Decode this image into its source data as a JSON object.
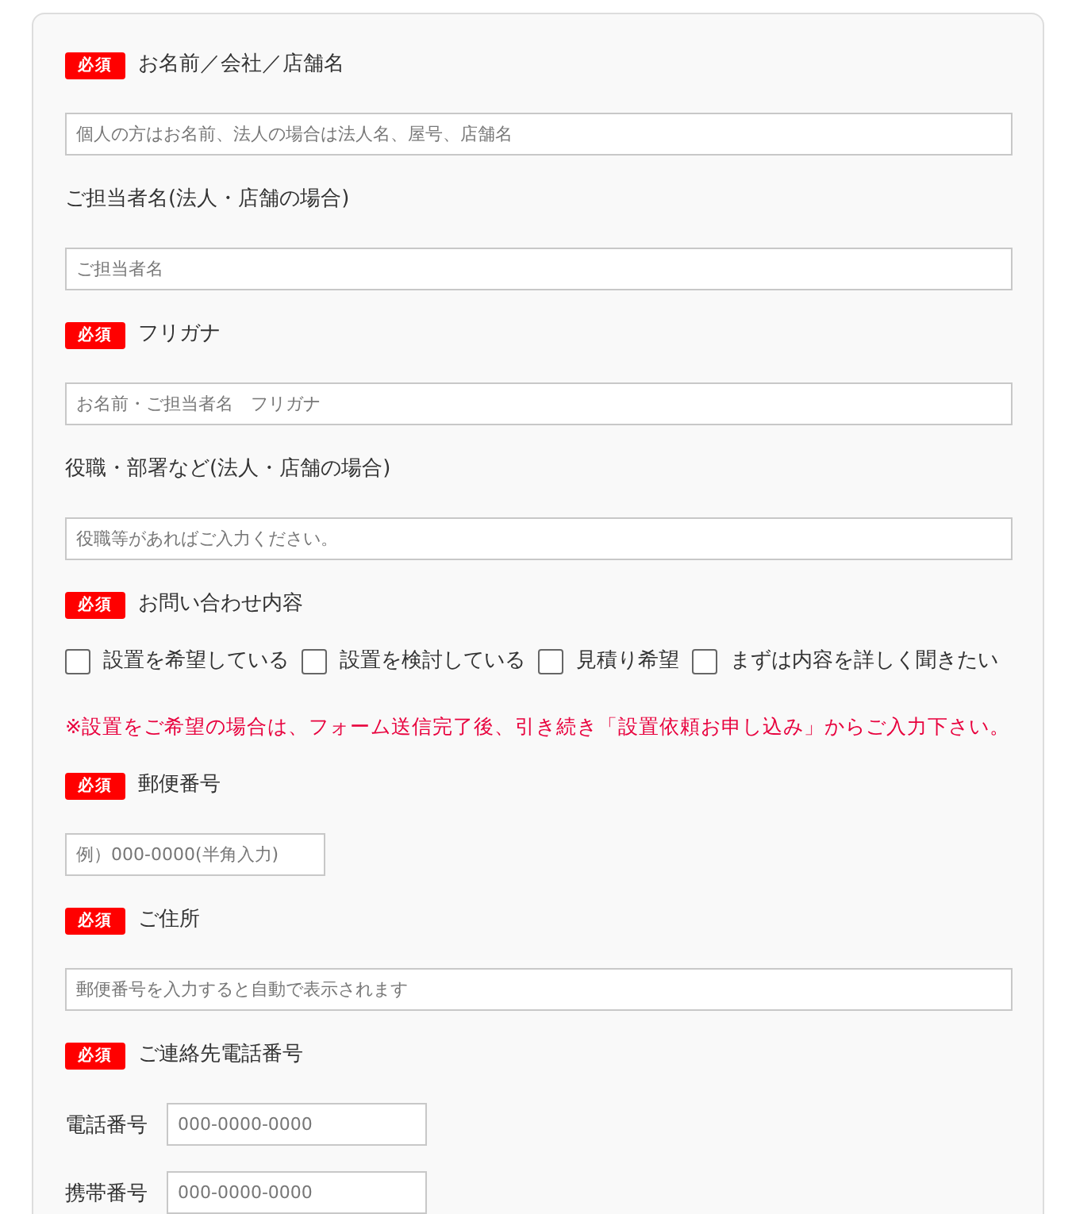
{
  "sections": [
    {
      "kind": "text",
      "badge": "必須",
      "label": "お名前／会社／店舗名",
      "placeholder": "個人の方はお名前、法人の場合は法人名、屋号、店舗名"
    },
    {
      "kind": "text",
      "label": "ご担当者名(法人・店舗の場合)",
      "placeholder": "ご担当者名"
    },
    {
      "kind": "text",
      "badge": "必須",
      "label": "フリガナ",
      "placeholder": "お名前・ご担当者名　フリガナ"
    },
    {
      "kind": "text",
      "label": "役職・部署など(法人・店舗の場合)",
      "placeholder": "役職等があればご入力ください。"
    },
    {
      "kind": "checkboxes",
      "badge": "必須",
      "label": "お問い合わせ内容",
      "options": [
        {
          "label": "設置を希望している",
          "checked": false
        },
        {
          "label": "設置を検討している",
          "checked": false
        },
        {
          "label": "見積り希望",
          "checked": false
        },
        {
          "label": "まずは内容を詳しく聞きたい",
          "checked": false
        }
      ],
      "note": "※設置をご希望の場合は、フォーム送信完了後、引き続き「設置依頼お申し込み」からご入力下さい。"
    },
    {
      "kind": "short_text",
      "badge": "必須",
      "label": "郵便番号",
      "placeholder": "例）000-0000(半角入力)"
    },
    {
      "kind": "text",
      "badge": "必須",
      "label": "ご住所",
      "placeholder": "郵便番号を入力すると自動で表示されます"
    },
    {
      "kind": "phones",
      "badge": "必須",
      "label": "ご連絡先電話番号",
      "rows": [
        {
          "label": "電話番号",
          "placeholder": "000-0000-0000"
        },
        {
          "label": "携帯番号",
          "placeholder": "000-0000-0000"
        }
      ]
    }
  ]
}
